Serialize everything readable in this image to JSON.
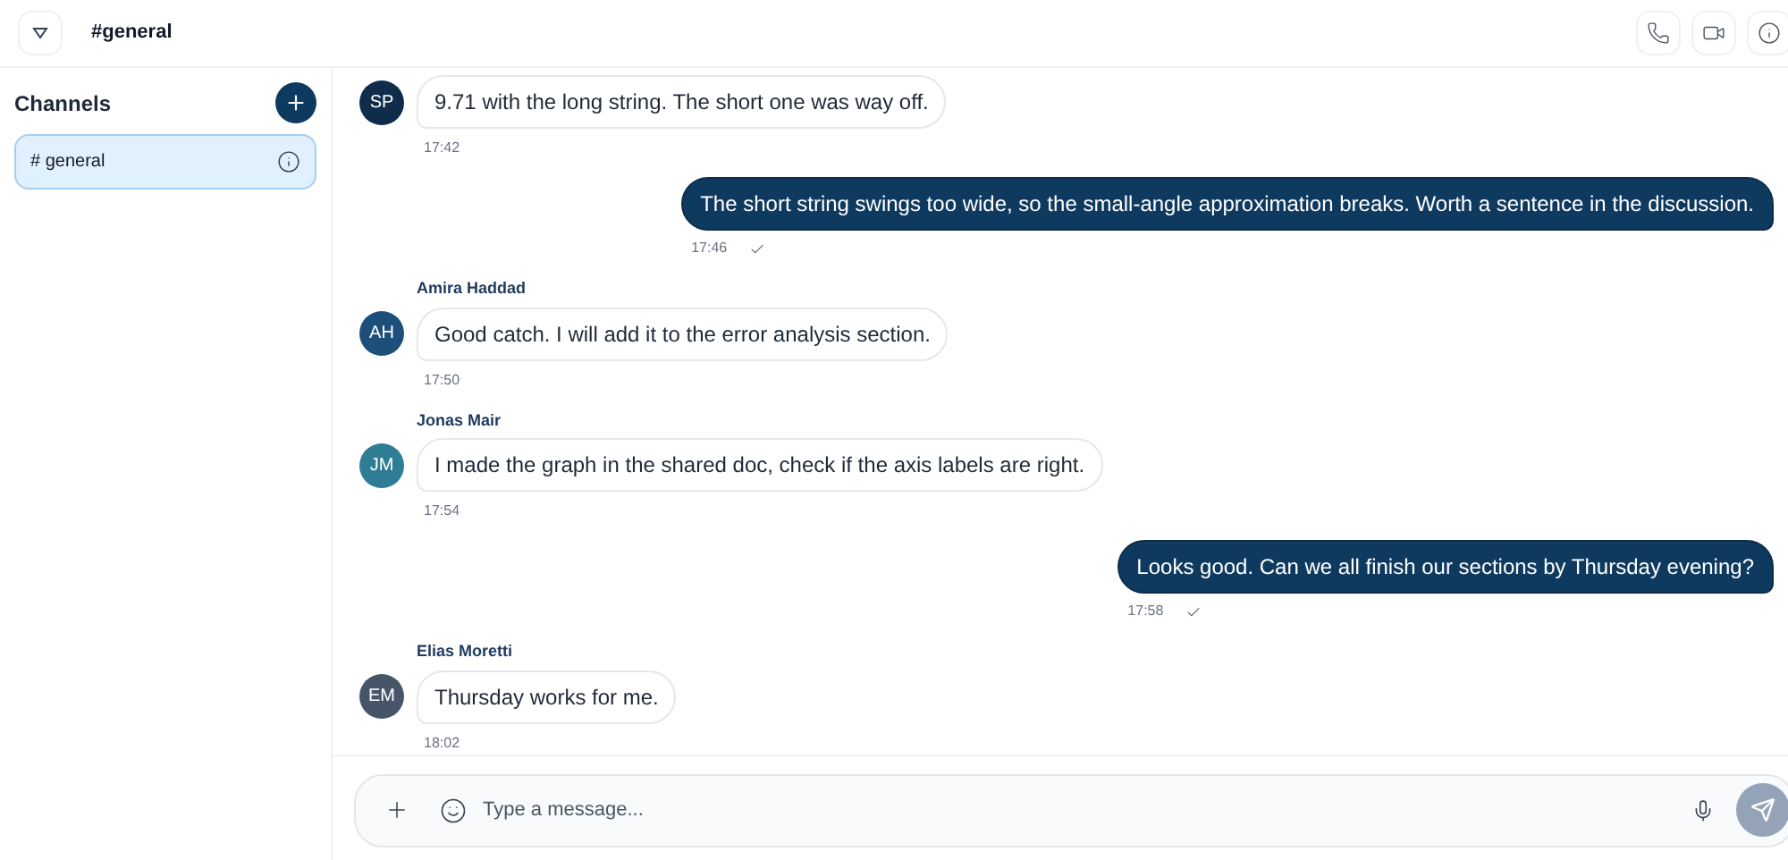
{
  "header": {
    "title": "#general"
  },
  "sidebar": {
    "title": "Channels",
    "channels": [
      {
        "label": "# general",
        "selected": true
      }
    ]
  },
  "messages": [
    {
      "kind": "incoming",
      "initials": "SP",
      "color": "#0f2d4a",
      "text": "9.71 with the long string. The short one was way off.",
      "time": "17:42"
    },
    {
      "kind": "outgoing",
      "text": "The short string swings too wide, so the small-angle approximation breaks. Worth a sentence in the discussion.",
      "time": "17:46"
    },
    {
      "kind": "incoming",
      "sender": "Amira Haddad",
      "initials": "AH",
      "color": "#1d4f7a",
      "text": "Good catch. I will add it to the error analysis section.",
      "time": "17:50"
    },
    {
      "kind": "incoming",
      "sender": "Jonas Mair",
      "initials": "JM",
      "color": "#2f7d95",
      "text": "I made the graph in the shared doc, check if the axis labels are right.",
      "time": "17:54"
    },
    {
      "kind": "outgoing",
      "text": "Looks good. Can we all finish our sections by Thursday evening?",
      "time": "17:58"
    },
    {
      "kind": "incoming",
      "sender": "Elias Moretti",
      "initials": "EM",
      "color": "#475569",
      "text": "Thursday works for me.",
      "time": "18:02"
    }
  ],
  "composer": {
    "placeholder": "Type a message..."
  }
}
